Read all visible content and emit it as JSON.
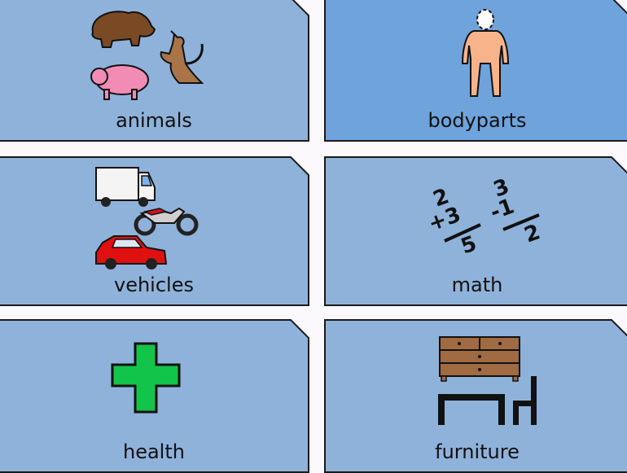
{
  "colors": {
    "tile": "#8fb2da",
    "tile_selected": "#6fa3dc",
    "background": "#fbf9fc"
  },
  "tiles": [
    {
      "label": "animals",
      "icon": "animals-icon"
    },
    {
      "label": "bodyparts",
      "icon": "body-icon"
    },
    {
      "label": "vehicles",
      "icon": "vehicles-icon"
    },
    {
      "label": "math",
      "icon": "math-icon",
      "icon_text": [
        "2",
        "+3",
        "5",
        "3",
        "-1",
        "2"
      ]
    },
    {
      "label": "health",
      "icon": "health-cross-icon"
    },
    {
      "label": "furniture",
      "icon": "furniture-icon"
    }
  ]
}
